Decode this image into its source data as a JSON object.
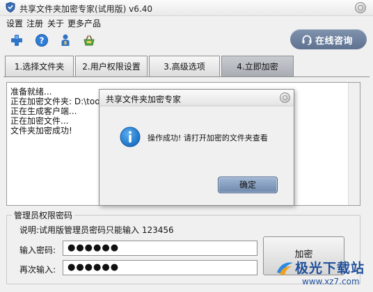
{
  "window": {
    "title": "共享文件夹加密专家(试用版) v6.40"
  },
  "menu": {
    "items": [
      "设置",
      "注册",
      "关于",
      "更多产品"
    ]
  },
  "toolbar": {
    "icons": [
      "add-icon",
      "help-icon",
      "user-icon",
      "basket-icon"
    ],
    "online_consult_label": "在线咨询",
    "online_consult_color": "#6d809f"
  },
  "tabs": [
    {
      "label": "1.选择文件夹",
      "active": false
    },
    {
      "label": "2.用户权限设置",
      "active": false
    },
    {
      "label": "3.高级选项",
      "active": false
    },
    {
      "label": "4.立即加密",
      "active": true
    }
  ],
  "log": {
    "lines": [
      "准备就绪...",
      "正在加密文件夹: D:\\too",
      "正在生成客户端...",
      "正在加密文件...",
      "文件夹加密成功!"
    ]
  },
  "password": {
    "group_title": "管理员权限密码",
    "hint": "说明:试用版管理员密码只能输入  123456",
    "input_label": "输入密码:",
    "input_value": "●●●●●●",
    "confirm_label": "再次输入:",
    "confirm_value": "●●●●●●",
    "encrypt_label": "加密"
  },
  "dialog": {
    "title": "共享文件夹加密专家",
    "message": "操作成功! 请打开加密的文件夹查看",
    "ok_label": "确定",
    "icon": "info-icon",
    "icon_color": "#1a78c9"
  },
  "watermark": {
    "brand": "极光下载站",
    "url": "www.xz7.com"
  }
}
